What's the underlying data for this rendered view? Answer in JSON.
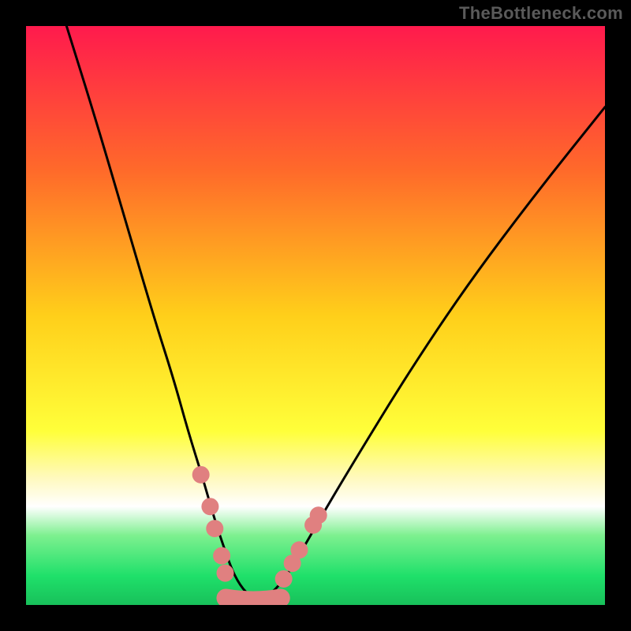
{
  "attribution": "TheBottleneck.com",
  "chart_data": {
    "type": "line",
    "title": "",
    "xlabel": "",
    "ylabel": "",
    "xlim": [
      0,
      100
    ],
    "ylim": [
      0,
      100
    ],
    "gradient_stops": [
      {
        "offset": 0,
        "color": "#ff1a4d"
      },
      {
        "offset": 0.25,
        "color": "#ff6a2a"
      },
      {
        "offset": 0.5,
        "color": "#ffcf1a"
      },
      {
        "offset": 0.7,
        "color": "#ffff3a"
      },
      {
        "offset": 0.78,
        "color": "#fff9bd"
      },
      {
        "offset": 0.83,
        "color": "#ffffff"
      },
      {
        "offset": 0.88,
        "color": "#7df08f"
      },
      {
        "offset": 0.95,
        "color": "#1fe06a"
      },
      {
        "offset": 1.0,
        "color": "#18c05a"
      }
    ],
    "series": [
      {
        "name": "bottleneck-curve",
        "x": [
          7,
          12,
          17,
          22,
          25.5,
          28,
          30.5,
          32.5,
          34.5,
          36,
          38,
          40,
          42.5,
          45,
          48,
          52,
          58,
          66,
          76,
          88,
          100
        ],
        "y": [
          100,
          84,
          67,
          50,
          39,
          30,
          22,
          15,
          9,
          5,
          2,
          1,
          2,
          5,
          10,
          17,
          27,
          40,
          55,
          71,
          86
        ]
      }
    ],
    "marker_clusters": [
      {
        "name": "left-cluster",
        "color": "#e08080",
        "points": [
          {
            "x": 30.2,
            "y": 22.5
          },
          {
            "x": 31.8,
            "y": 17.0
          },
          {
            "x": 32.6,
            "y": 13.2
          },
          {
            "x": 33.8,
            "y": 8.5
          },
          {
            "x": 34.4,
            "y": 5.5
          }
        ]
      },
      {
        "name": "right-cluster",
        "color": "#e08080",
        "points": [
          {
            "x": 44.5,
            "y": 4.5
          },
          {
            "x": 46.0,
            "y": 7.2
          },
          {
            "x": 47.2,
            "y": 9.5
          },
          {
            "x": 49.6,
            "y": 13.8
          },
          {
            "x": 50.5,
            "y": 15.5
          }
        ]
      }
    ],
    "trough_band": {
      "name": "trough-band",
      "color": "#e08080",
      "x_range": [
        34.5,
        44.0
      ],
      "y": 1.2,
      "thickness": 3.2
    }
  }
}
